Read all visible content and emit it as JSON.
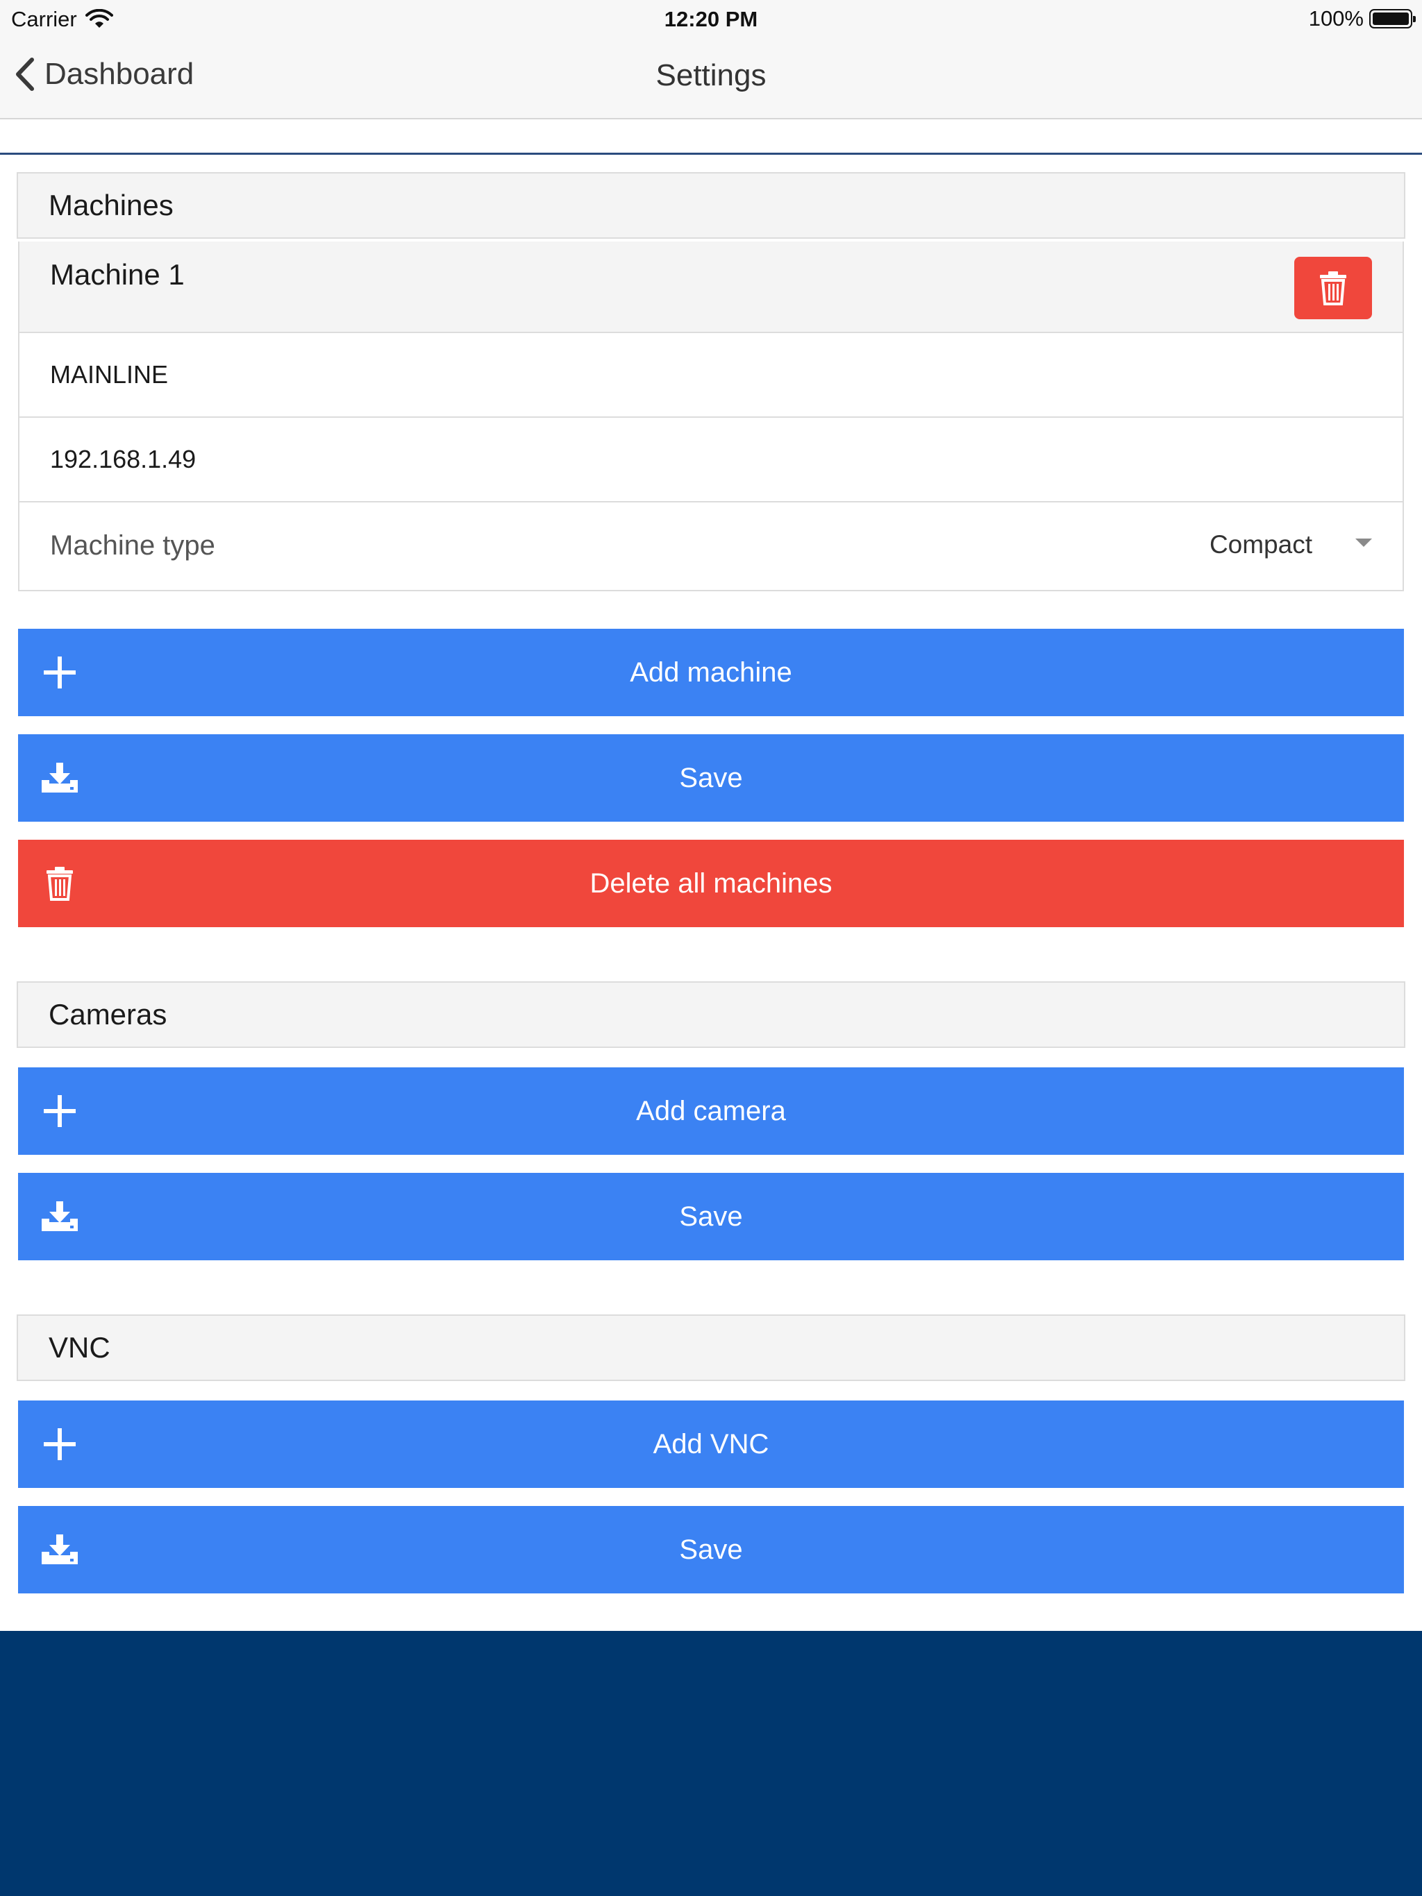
{
  "status_bar": {
    "carrier": "Carrier",
    "time": "12:20 PM",
    "battery": "100%"
  },
  "nav": {
    "back_label": "Dashboard",
    "title": "Settings"
  },
  "machines": {
    "header": "Machines",
    "items": [
      {
        "name": "Machine 1",
        "line": "MAINLINE",
        "ip": "192.168.1.49",
        "type_label": "Machine type",
        "type_value": "Compact"
      }
    ],
    "add_label": "Add machine",
    "save_label": "Save",
    "delete_all_label": "Delete all machines"
  },
  "cameras": {
    "header": "Cameras",
    "add_label": "Add camera",
    "save_label": "Save"
  },
  "vnc": {
    "header": "VNC",
    "add_label": "Add VNC",
    "save_label": "Save"
  },
  "colors": {
    "primary": "#3b82f3",
    "danger": "#f0473c",
    "footer": "#00376e"
  },
  "icons": {
    "add": "plus-icon",
    "save": "download-tray-icon",
    "delete": "trash-icon",
    "back": "chevron-left-icon",
    "wifi": "wifi-icon",
    "battery": "battery-icon"
  }
}
